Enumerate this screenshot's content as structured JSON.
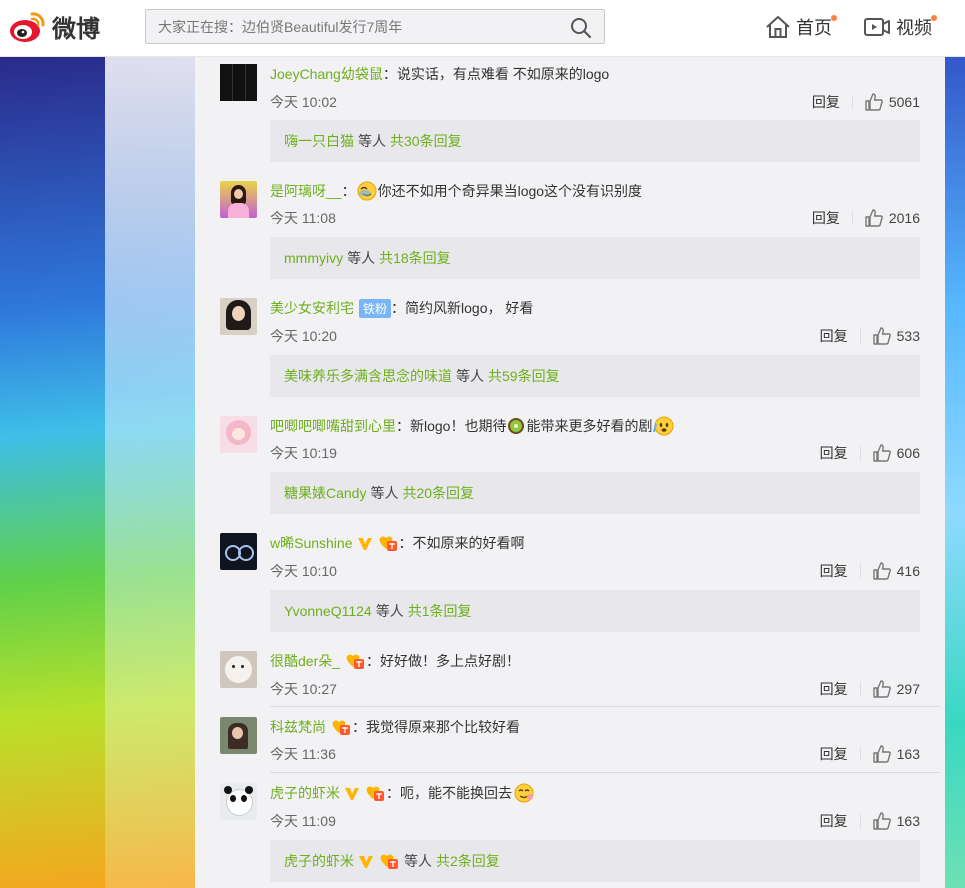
{
  "header": {
    "logo_text": "微博",
    "search_placeholder": "大家正在搜：边伯贤Beautiful发行7周年",
    "nav_home": "首页",
    "nav_video": "视频"
  },
  "colors": {
    "accent_green": "#6eaf1c",
    "brand_red": "#e6162d",
    "notify_dot": "#ff8140"
  },
  "comments": [
    {
      "user": "JoeyChang幼袋鼠",
      "text": "说实话，有点难看 不如原来的logo",
      "time": "今天 10:02",
      "reply_label": "回复",
      "likes": "5061",
      "replies": {
        "who": "嗨一只白猫",
        "etc": "等人",
        "total": "共30条回复"
      }
    },
    {
      "user": "是阿璃呀__",
      "text": "你还不如用个奇异果当logo这个没有识别度",
      "time": "今天 11:08",
      "reply_label": "回复",
      "likes": "2016",
      "replies": {
        "who": "mmmyivy",
        "etc": "等人",
        "total": "共18条回复"
      }
    },
    {
      "user": "美少女安利宅",
      "badge": "铁粉",
      "text": "简约风新logo， 好看",
      "time": "今天 10:20",
      "reply_label": "回复",
      "likes": "533",
      "replies": {
        "who": "美味养乐多满含思念的味道",
        "etc": "等人",
        "total": "共59条回复"
      }
    },
    {
      "user": "吧唧吧唧嘴甜到心里",
      "text_a": "新logo！也期待",
      "text_b": "能带来更多好看的剧",
      "time": "今天 10:19",
      "reply_label": "回复",
      "likes": "606",
      "replies": {
        "who": "糖果婊Candy",
        "etc": "等人",
        "total": "共20条回复"
      }
    },
    {
      "user": "w晞Sunshine",
      "text": "不如原来的好看啊",
      "time": "今天 10:10",
      "reply_label": "回复",
      "likes": "416",
      "replies": {
        "who": "YvonneQ1124",
        "etc": "等人",
        "total": "共1条回复"
      }
    },
    {
      "user": "很酷der朵_",
      "text": "好好做！多上点好剧！",
      "time": "今天 10:27",
      "reply_label": "回复",
      "likes": "297"
    },
    {
      "user": "科兹梵尚",
      "text": "我觉得原来那个比较好看",
      "time": "今天 11:36",
      "reply_label": "回复",
      "likes": "163"
    },
    {
      "user": "虎子的虾米",
      "text": "呃，能不能换回去",
      "time": "今天 11:09",
      "reply_label": "回复",
      "likes": "163",
      "replies": {
        "who": "虎子的虾米",
        "etc": "等人",
        "total": "共2条回复"
      }
    }
  ],
  "icons": [
    "weibo-logo-icon",
    "search-icon",
    "home-icon",
    "video-icon",
    "like-icon",
    "vip-v-icon",
    "fan-medal-icon",
    "emoji-icon"
  ]
}
